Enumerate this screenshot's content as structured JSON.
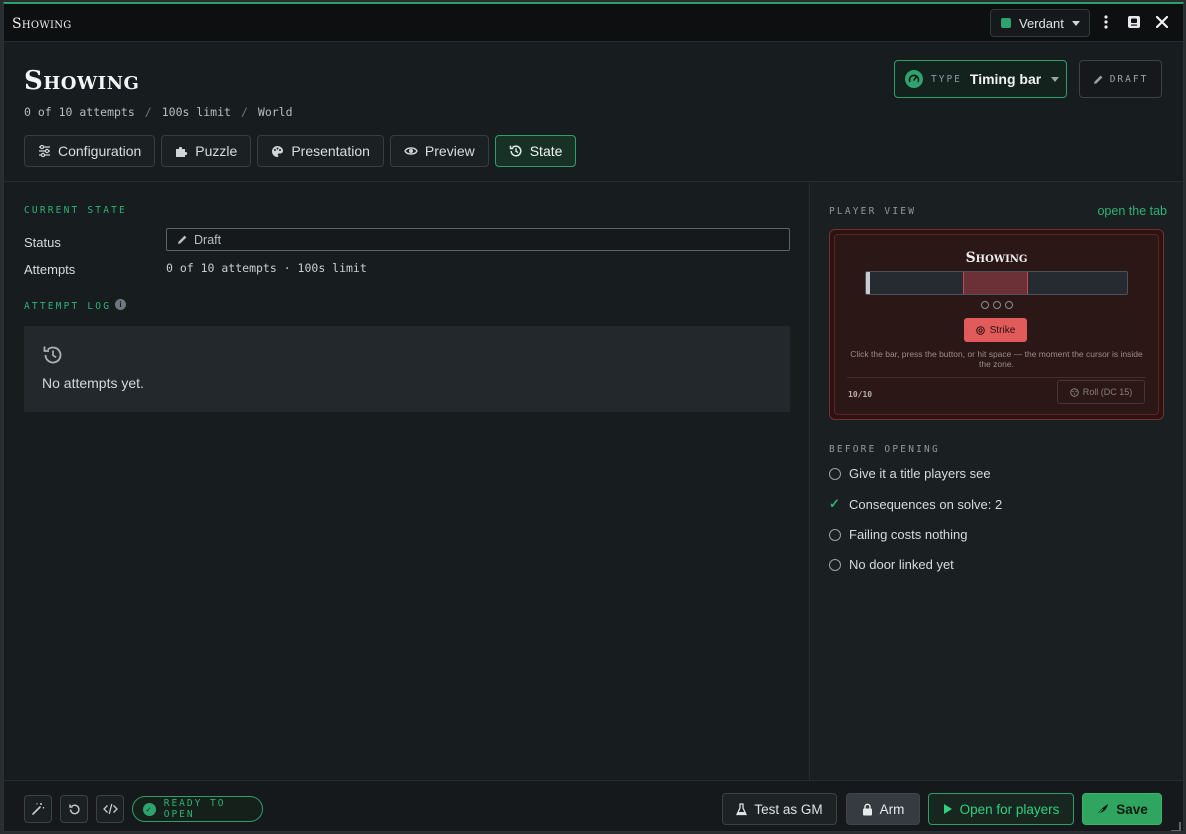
{
  "window": {
    "title": "Showing",
    "theme": {
      "name": "Verdant",
      "color": "#2fa36d"
    }
  },
  "header": {
    "title": "Showing",
    "meta": [
      "0 of 10 attempts",
      "100s limit",
      "World"
    ],
    "meta_separator": "/",
    "type_label": "TYPE",
    "type_value": "Timing bar",
    "draft_label": "DRAFT"
  },
  "tabs": [
    {
      "label": "Configuration",
      "icon": "sliders-icon"
    },
    {
      "label": "Puzzle",
      "icon": "puzzle-icon"
    },
    {
      "label": "Presentation",
      "icon": "palette-icon"
    },
    {
      "label": "Preview",
      "icon": "eye-icon"
    },
    {
      "label": "State",
      "icon": "history-icon",
      "active": true
    }
  ],
  "current_state": {
    "section_label": "CURRENT STATE",
    "status_label": "Status",
    "status_value": "Draft",
    "attempts_label": "Attempts",
    "attempts_value": "0 of 10 attempts · 100s limit"
  },
  "attempt_log": {
    "section_label": "ATTEMPT LOG",
    "empty_text": "No attempts yet."
  },
  "player_view": {
    "section_label": "PLAYER VIEW",
    "open_link": "open the tab",
    "title": "Showing",
    "zone_start": 0.37,
    "zone_end": 0.62,
    "cursor_position": 0.0,
    "strike_label": "Strike",
    "hint": "Click the bar, press the button, or hit space — the moment the cursor is inside the zone.",
    "count": "10/10",
    "roll_label": "Roll (DC 15)"
  },
  "before_opening": {
    "section_label": "BEFORE OPENING",
    "items": [
      {
        "label": "Give it a title players see",
        "done": false
      },
      {
        "label": "Consequences on solve: 2",
        "done": true
      },
      {
        "label": "Failing costs nothing",
        "done": false
      },
      {
        "label": "No door linked yet",
        "done": false
      }
    ]
  },
  "footer": {
    "ready_label": "READY TO OPEN",
    "test_label": "Test as GM",
    "arm_label": "Arm",
    "open_label": "Open for players",
    "save_label": "Save"
  }
}
